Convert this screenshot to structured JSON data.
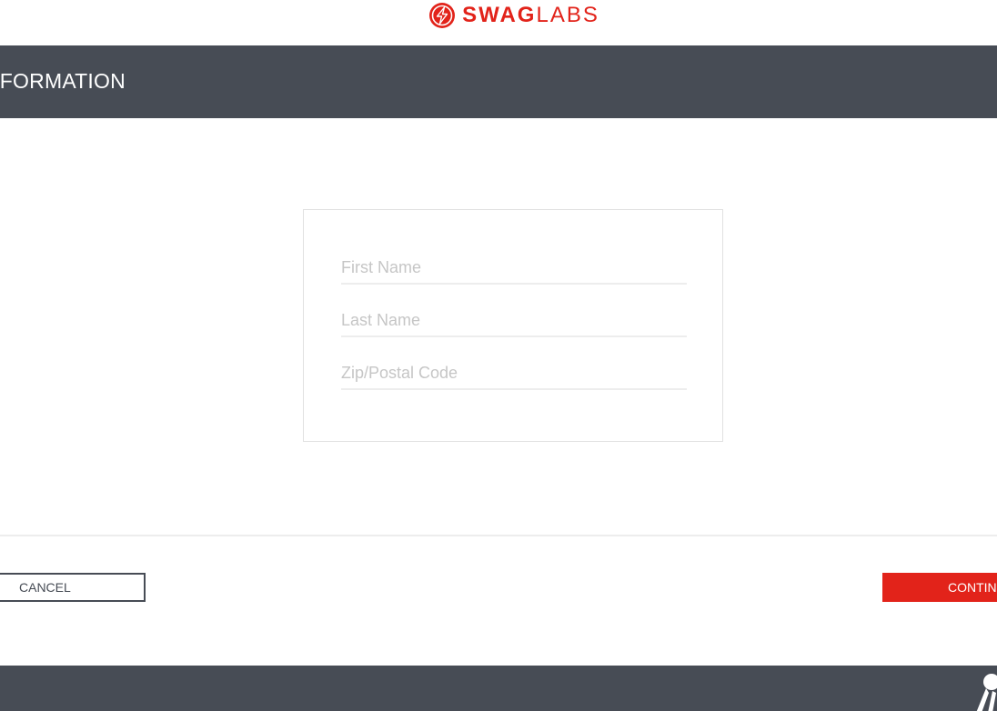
{
  "header": {
    "brand_bold": "SWAG",
    "brand_light": "LABS",
    "logo_icon": "lightning-bolt-icon",
    "brand_color": "#e2231a"
  },
  "subheader": {
    "title": "NFORMATION"
  },
  "form": {
    "first_name_placeholder": "First Name",
    "last_name_placeholder": "Last Name",
    "zip_placeholder": "Zip/Postal Code",
    "first_name_value": "",
    "last_name_value": "",
    "zip_value": ""
  },
  "actions": {
    "cancel_label": "CANCEL",
    "continue_label": "CONTIN"
  },
  "footer": {
    "icon": "robot-icon",
    "background": "#474c55"
  }
}
